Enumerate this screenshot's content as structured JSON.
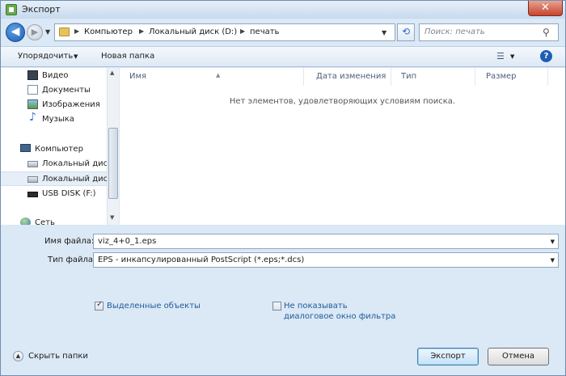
{
  "window": {
    "title": "Экспорт",
    "close_glyph": "✕"
  },
  "address": {
    "back_glyph": "◀",
    "fwd_glyph": "▶",
    "crumbs": [
      "Компьютер",
      "Локальный диск (D:)",
      "печать"
    ],
    "refresh_glyph": "⟲"
  },
  "search": {
    "placeholder": "Поиск: печать",
    "icon": "search-icon"
  },
  "toolbar": {
    "organize_label": "Упорядочить",
    "new_folder_label": "Новая папка",
    "views_glyph": "☰",
    "help_glyph": "?"
  },
  "nav": {
    "items": [
      {
        "label": "Видео",
        "icon": "video-icon"
      },
      {
        "label": "Документы",
        "icon": "documents-icon"
      },
      {
        "label": "Изображения",
        "icon": "pictures-icon"
      },
      {
        "label": "Музыка",
        "icon": "music-icon"
      },
      {
        "label": "Компьютер",
        "icon": "computer-icon"
      },
      {
        "label": "Локальный диск",
        "icon": "drive-icon"
      },
      {
        "label": "Локальный диск",
        "icon": "drive-icon",
        "selected": true
      },
      {
        "label": "USB DISK (F:)",
        "icon": "usb-icon"
      },
      {
        "label": "Сеть",
        "icon": "network-icon"
      }
    ]
  },
  "filelist": {
    "columns": [
      "Имя",
      "Дата изменения",
      "Тип",
      "Размер"
    ],
    "empty_message": "Нет элементов, удовлетворяющих условиям поиска."
  },
  "form": {
    "filename_label": "Имя файла:",
    "filename_value": "viz_4+0_1.eps",
    "filetype_label": "Тип файла:",
    "filetype_value": "EPS - инкапсулированный PostScript (*.eps;*.dcs)"
  },
  "options": {
    "selected_objects_label": "Выделенные объекты",
    "selected_objects_checked": true,
    "no_filter_dialog_line1": "Не показывать",
    "no_filter_dialog_line2": "диалоговое окно фильтра",
    "no_filter_dialog_checked": false
  },
  "footer": {
    "hide_folders_label": "Скрыть папки",
    "export_label": "Экспорт",
    "cancel_label": "Отмена"
  }
}
